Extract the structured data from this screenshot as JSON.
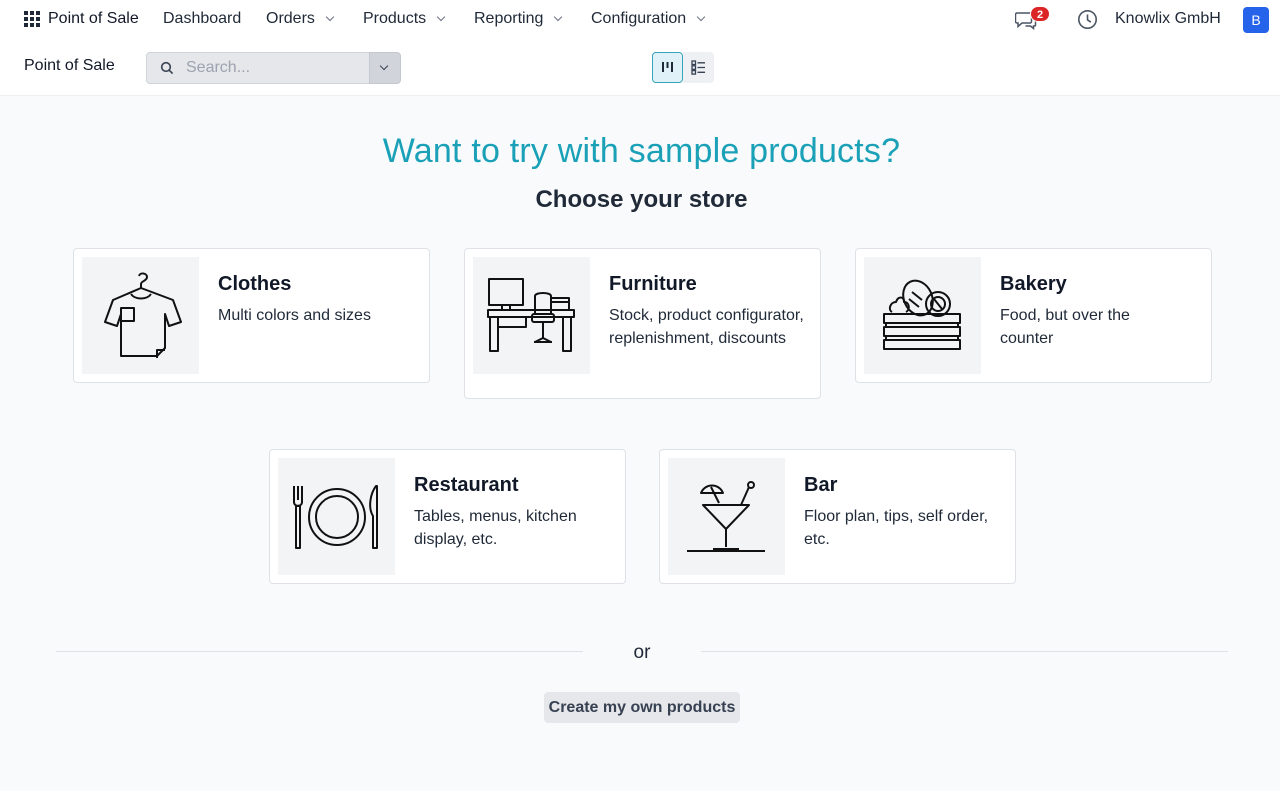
{
  "navbar": {
    "app_name": "Point of Sale",
    "menus": [
      {
        "label": "Dashboard"
      },
      {
        "label": "Orders"
      },
      {
        "label": "Products"
      },
      {
        "label": "Reporting"
      },
      {
        "label": "Configuration"
      }
    ],
    "messages_count": "2",
    "company": "Knowlix GmbH",
    "avatar_initial": "B",
    "icons": [
      "apps-grid-icon",
      "chat-icon",
      "clock-icon"
    ]
  },
  "control_panel": {
    "breadcrumb": "Point of Sale",
    "search": {
      "placeholder": "Search...",
      "value": ""
    },
    "views": [
      "kanban-view-icon",
      "list-view-icon"
    ]
  },
  "main": {
    "headline": "Want to try with sample products?",
    "subheadline": "Choose your store",
    "stores": [
      {
        "title": "Clothes",
        "desc": "Multi colors and sizes",
        "icon": "tshirt-icon"
      },
      {
        "title": "Furniture",
        "desc": "Stock, product configurator, replenishment, discounts",
        "icon": "desk-icon"
      },
      {
        "title": "Bakery",
        "desc": "Food, but over the counter",
        "icon": "bread-crate-icon"
      },
      {
        "title": "Restaurant",
        "desc": "Tables, menus, kitchen display, etc.",
        "icon": "plate-cutlery-icon"
      },
      {
        "title": "Bar",
        "desc": "Floor plan, tips, self order, etc.",
        "icon": "cocktail-icon"
      }
    ],
    "or_label": "or",
    "create_button": "Create my own products"
  },
  "colors": {
    "accent": "#1aa1b8",
    "avatar_bg": "#2563eb",
    "badge_bg": "#dc2626"
  }
}
